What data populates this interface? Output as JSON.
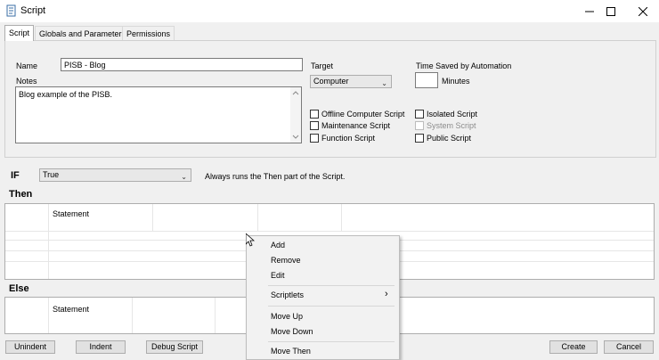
{
  "window": {
    "title": "Script",
    "icon": "script-app-icon",
    "controls": [
      "minimize-icon",
      "maximize-icon",
      "close-icon"
    ]
  },
  "tabs": [
    {
      "label": "Script",
      "active": true
    },
    {
      "label": "Globals and Parameters",
      "active": false
    },
    {
      "label": "Permissions",
      "active": false
    }
  ],
  "form": {
    "name_label": "Name",
    "name_value": "PISB - Blog",
    "notes_label": "Notes",
    "notes_value": "Blog example of the PISB.",
    "target_label": "Target",
    "target_value": "Computer",
    "time_saved_label": "Time Saved by Automation",
    "time_saved_value": "",
    "minutes_label": "Minutes",
    "checkboxes_left": [
      {
        "label": "Offline Computer Script",
        "checked": false,
        "enabled": true
      },
      {
        "label": "Maintenance Script",
        "checked": false,
        "enabled": true
      },
      {
        "label": "Function Script",
        "checked": false,
        "enabled": true
      }
    ],
    "checkboxes_right": [
      {
        "label": "Isolated Script",
        "checked": false,
        "enabled": true
      },
      {
        "label": "System Script",
        "checked": false,
        "enabled": false
      },
      {
        "label": "Public Script",
        "checked": false,
        "enabled": true
      }
    ]
  },
  "if_row": {
    "label": "IF",
    "condition": "True",
    "description": "Always runs the Then part of the Script."
  },
  "then_section": {
    "label": "Then",
    "column_header": "Statement"
  },
  "else_section": {
    "label": "Else",
    "column_header": "Statement"
  },
  "footer": {
    "unindent": "Unindent",
    "indent": "Indent",
    "debug": "Debug Script",
    "create": "Create",
    "cancel": "Cancel"
  },
  "context_menu": {
    "items": [
      "Add",
      "Remove",
      "Edit",
      "Scriptlets",
      "Move Up",
      "Move Down",
      "Move Then"
    ],
    "submenu_arrow": "›"
  },
  "colors": {
    "window_bg": "#f0f0f0",
    "titlebar_bg": "#ffffff",
    "grid_bg": "#ffffff"
  }
}
